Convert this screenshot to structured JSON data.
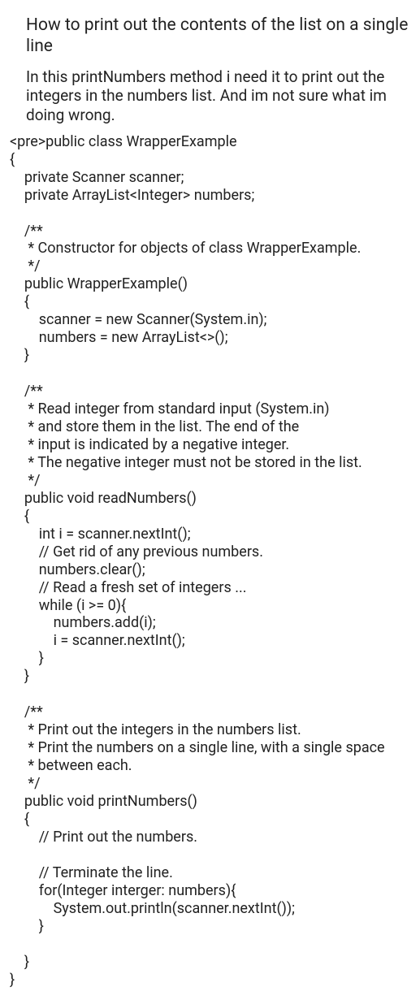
{
  "title": "How to print out the contents of the list on a single line",
  "description": "In this printNumbers method i need it to print out the integers in the numbers list. And im not sure what im doing wrong.",
  "code": "<pre>public class WrapperExample\n{\n    private Scanner scanner;\n    private ArrayList<Integer> numbers;\n\n    /**\n     * Constructor for objects of class WrapperExample.\n     */\n    public WrapperExample()\n    {\n        scanner = new Scanner(System.in);\n        numbers = new ArrayList<>();\n    }\n\n    /**\n     * Read integer from standard input (System.in)\n     * and store them in the list. The end of the\n     * input is indicated by a negative integer.\n     * The negative integer must not be stored in the list.\n     */\n    public void readNumbers()\n    {\n        int i = scanner.nextInt();\n        // Get rid of any previous numbers.\n        numbers.clear();\n        // Read a fresh set of integers ...\n        while (i >= 0){\n            numbers.add(i);\n            i = scanner.nextInt();\n        }\n    }\n\n    /**\n     * Print out the integers in the numbers list.\n     * Print the numbers on a single line, with a single space\n     * between each.\n     */\n    public void printNumbers()\n    {\n        // Print out the numbers.\n\n        // Terminate the line.\n        for(Integer interger: numbers){\n            System.out.println(scanner.nextInt());\n        }\n\n    }\n}"
}
